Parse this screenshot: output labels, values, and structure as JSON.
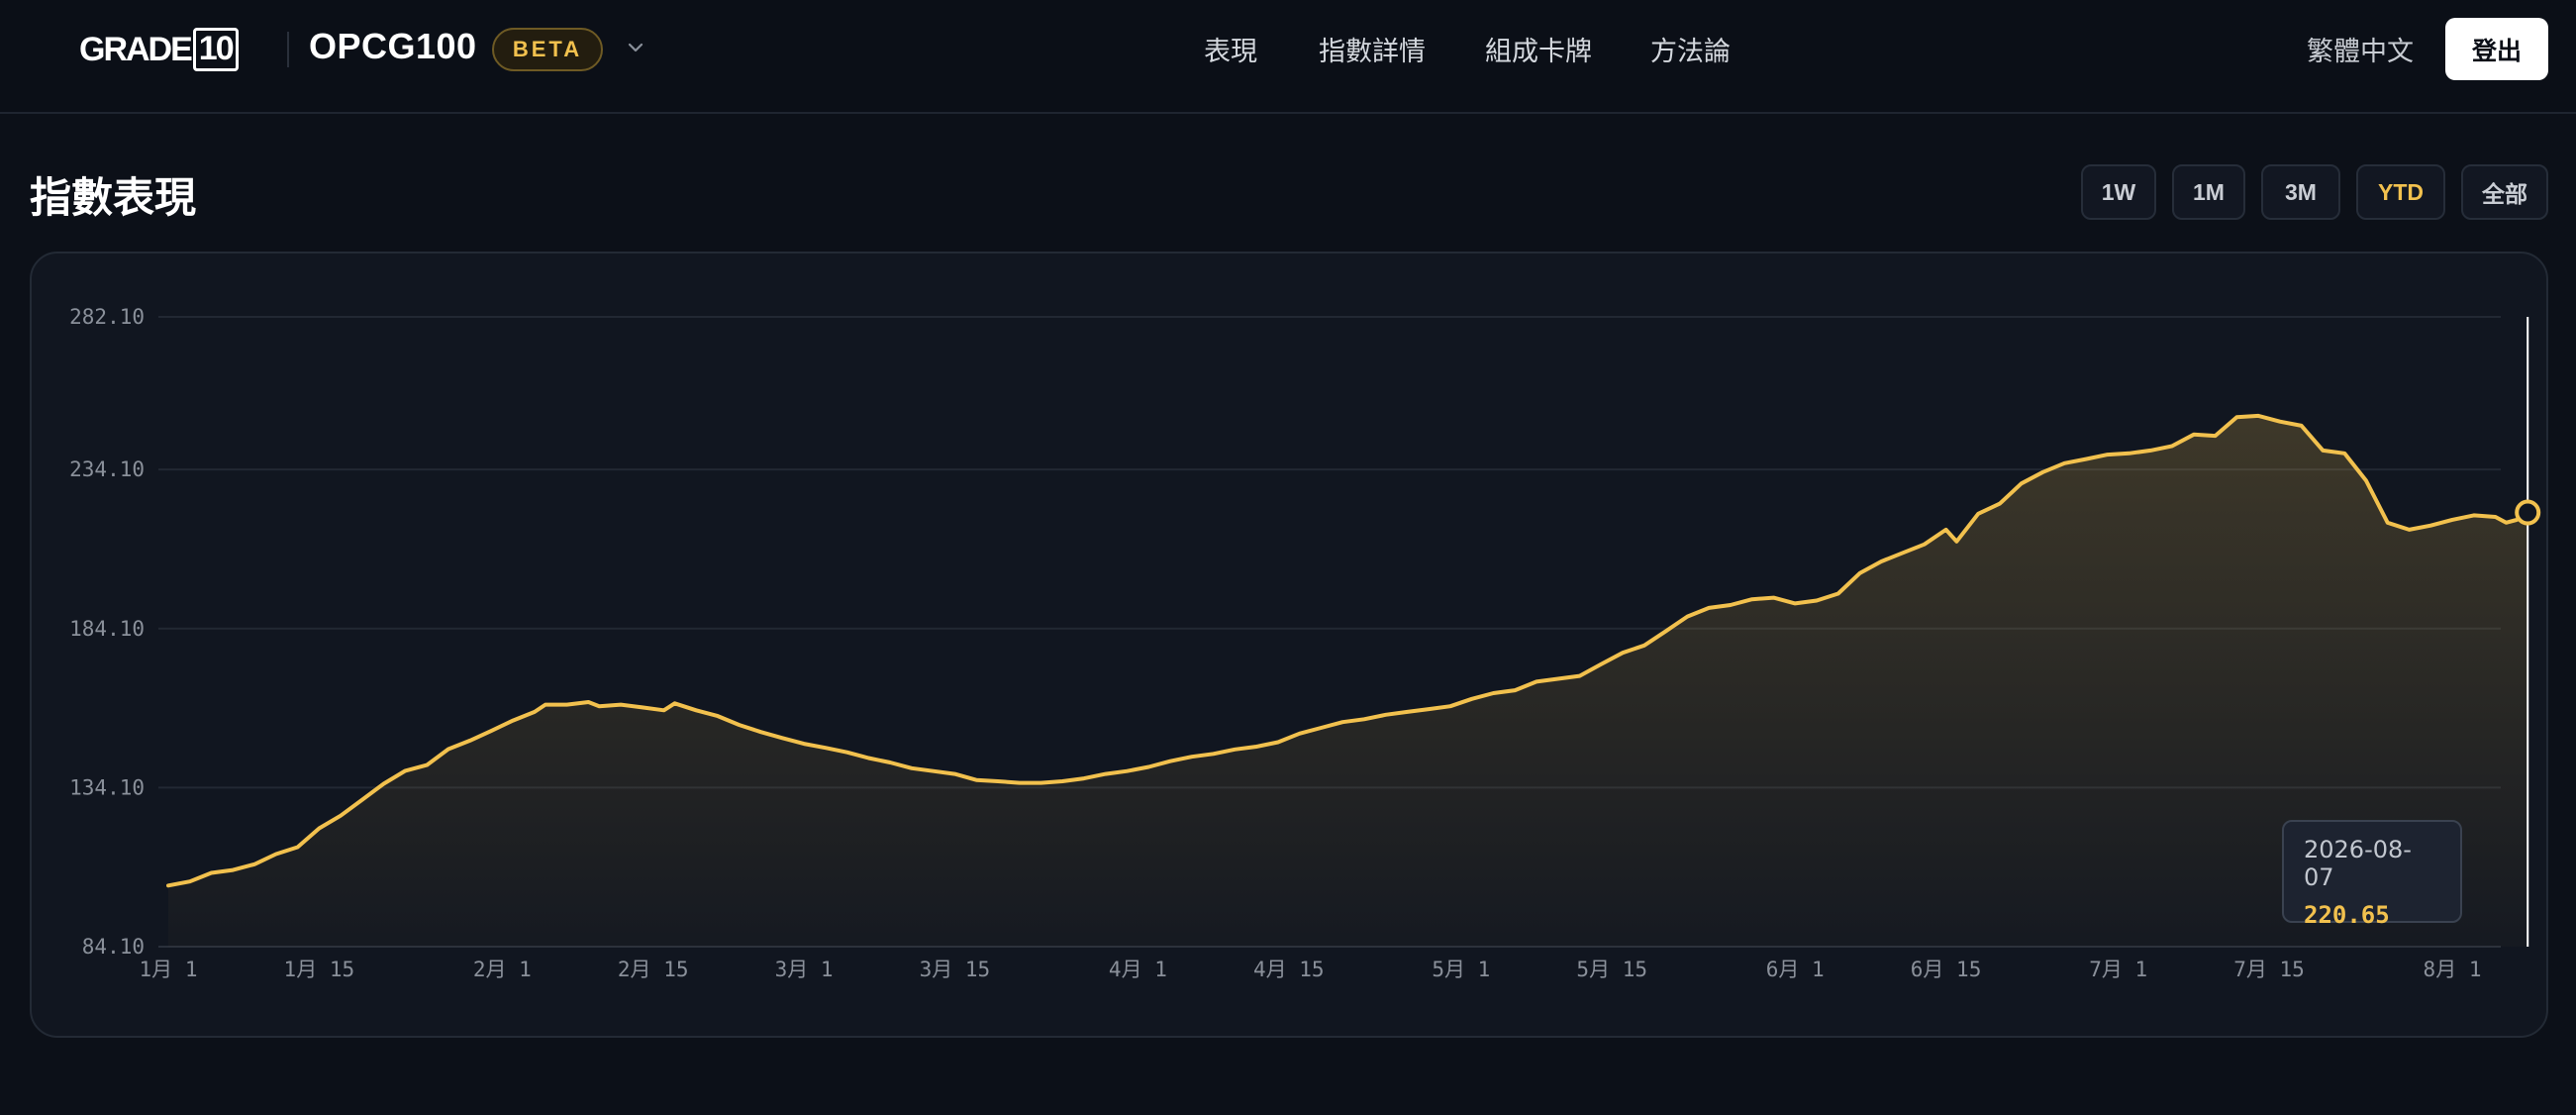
{
  "header": {
    "logo_main": "GRADE",
    "logo_num": "10",
    "product": "OPCG100",
    "badge": "BETA",
    "nav": [
      "表現",
      "指數詳情",
      "組成卡牌",
      "方法論"
    ],
    "language": "繁體中文",
    "logout": "登出"
  },
  "section": {
    "title": "指數表現",
    "ranges": [
      "1W",
      "1M",
      "3M",
      "YTD",
      "全部"
    ],
    "active_range": "YTD"
  },
  "colors": {
    "accent": "#f2c14e",
    "background": "#0c1018",
    "card": "#111620"
  },
  "tooltip": {
    "date": "2026-08-07",
    "value": "220.65"
  },
  "chart_data": {
    "type": "area",
    "ylim": [
      84.1,
      282.1
    ],
    "y_ticks": [
      "282.10",
      "234.10",
      "184.10",
      "134.10",
      "84.10"
    ],
    "x_ticks": [
      {
        "day": 0,
        "label": "1月 1"
      },
      {
        "day": 14,
        "label": "1月 15"
      },
      {
        "day": 31,
        "label": "2月 1"
      },
      {
        "day": 45,
        "label": "2月 15"
      },
      {
        "day": 59,
        "label": "3月 1"
      },
      {
        "day": 73,
        "label": "3月 15"
      },
      {
        "day": 90,
        "label": "4月 1"
      },
      {
        "day": 104,
        "label": "4月 15"
      },
      {
        "day": 120,
        "label": "5月 1"
      },
      {
        "day": 134,
        "label": "5月 15"
      },
      {
        "day": 151,
        "label": "6月 1"
      },
      {
        "day": 165,
        "label": "6月 15"
      },
      {
        "day": 181,
        "label": "7月 1"
      },
      {
        "day": 195,
        "label": "7月 15"
      },
      {
        "day": 212,
        "label": "8月 1"
      }
    ],
    "grid": true,
    "series": [
      {
        "points": [
          [
            0,
            103.3
          ],
          [
            2,
            104.6
          ],
          [
            4,
            107.3
          ],
          [
            6,
            108.2
          ],
          [
            8,
            110.0
          ],
          [
            10,
            113.2
          ],
          [
            12,
            115.4
          ],
          [
            14,
            121.3
          ],
          [
            16,
            125.3
          ],
          [
            18,
            130.3
          ],
          [
            20,
            135.3
          ],
          [
            22,
            139.4
          ],
          [
            24,
            141.2
          ],
          [
            26,
            146.2
          ],
          [
            28,
            148.9
          ],
          [
            30,
            152.0
          ],
          [
            32,
            155.2
          ],
          [
            34,
            157.9
          ],
          [
            35,
            160.2
          ],
          [
            37,
            160.2
          ],
          [
            39,
            161.0
          ],
          [
            40,
            159.7
          ],
          [
            42,
            160.2
          ],
          [
            44,
            159.3
          ],
          [
            46,
            158.4
          ],
          [
            47,
            160.6
          ],
          [
            49,
            158.4
          ],
          [
            51,
            156.6
          ],
          [
            53,
            153.8
          ],
          [
            55,
            151.6
          ],
          [
            57,
            149.7
          ],
          [
            59,
            147.9
          ],
          [
            61,
            146.6
          ],
          [
            63,
            145.2
          ],
          [
            65,
            143.4
          ],
          [
            67,
            142.0
          ],
          [
            69,
            140.2
          ],
          [
            71,
            139.3
          ],
          [
            73,
            138.4
          ],
          [
            75,
            136.5
          ],
          [
            77,
            136.1
          ],
          [
            79,
            135.6
          ],
          [
            81,
            135.6
          ],
          [
            83,
            136.1
          ],
          [
            85,
            137.0
          ],
          [
            87,
            138.4
          ],
          [
            89,
            139.3
          ],
          [
            91,
            140.6
          ],
          [
            93,
            142.4
          ],
          [
            95,
            143.8
          ],
          [
            97,
            144.7
          ],
          [
            99,
            146.1
          ],
          [
            101,
            147.0
          ],
          [
            103,
            148.4
          ],
          [
            105,
            151.1
          ],
          [
            107,
            152.9
          ],
          [
            109,
            154.7
          ],
          [
            111,
            155.6
          ],
          [
            113,
            157.0
          ],
          [
            115,
            157.9
          ],
          [
            117,
            158.8
          ],
          [
            119,
            159.7
          ],
          [
            121,
            162.0
          ],
          [
            123,
            163.8
          ],
          [
            125,
            164.7
          ],
          [
            127,
            167.4
          ],
          [
            129,
            168.3
          ],
          [
            131,
            169.2
          ],
          [
            133,
            172.9
          ],
          [
            135,
            176.5
          ],
          [
            137,
            178.8
          ],
          [
            139,
            183.3
          ],
          [
            141,
            187.9
          ],
          [
            143,
            190.6
          ],
          [
            145,
            191.5
          ],
          [
            147,
            193.3
          ],
          [
            149,
            193.8
          ],
          [
            151,
            192.0
          ],
          [
            153,
            192.9
          ],
          [
            155,
            195.1
          ],
          [
            157,
            201.5
          ],
          [
            159,
            205.2
          ],
          [
            161,
            207.9
          ],
          [
            163,
            210.6
          ],
          [
            165,
            215.2
          ],
          [
            166,
            211.5
          ],
          [
            168,
            220.2
          ],
          [
            170,
            223.4
          ],
          [
            172,
            229.7
          ],
          [
            174,
            233.3
          ],
          [
            176,
            236.1
          ],
          [
            178,
            237.4
          ],
          [
            180,
            238.8
          ],
          [
            182,
            239.2
          ],
          [
            184,
            240.1
          ],
          [
            186,
            241.5
          ],
          [
            188,
            245.1
          ],
          [
            190,
            244.7
          ],
          [
            192,
            250.6
          ],
          [
            194,
            251.0
          ],
          [
            196,
            249.2
          ],
          [
            198,
            247.9
          ],
          [
            200,
            240.1
          ],
          [
            202,
            239.2
          ],
          [
            204,
            230.6
          ],
          [
            206,
            217.4
          ],
          [
            208,
            215.2
          ],
          [
            210,
            216.5
          ],
          [
            212,
            218.3
          ],
          [
            214,
            219.7
          ],
          [
            216,
            219.2
          ],
          [
            217,
            217.4
          ],
          [
            218,
            218.3
          ],
          [
            219,
            220.6
          ]
        ]
      }
    ],
    "x_domain": [
      0,
      219
    ]
  }
}
